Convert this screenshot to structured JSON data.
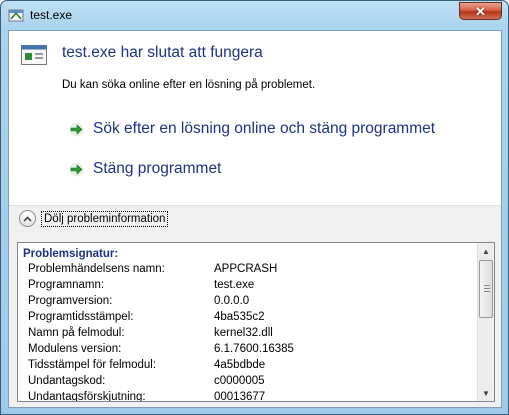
{
  "window": {
    "title": "test.exe"
  },
  "dialog": {
    "heading": "test.exe har slutat att fungera",
    "subtext": "Du kan söka online efter en lösning på problemet.",
    "commands": [
      {
        "label": "Sök efter en lösning online och stäng programmet"
      },
      {
        "label": "Stäng programmet"
      }
    ],
    "details_toggle": "Dölj probleminformation"
  },
  "details": {
    "header": "Problemsignatur:",
    "rows": [
      {
        "key": "Problemhändelsens namn:",
        "value": "APPCRASH"
      },
      {
        "key": "Programnamn:",
        "value": "test.exe"
      },
      {
        "key": "Programversion:",
        "value": "0.0.0.0"
      },
      {
        "key": "Programtidsstämpel:",
        "value": "4ba535c2"
      },
      {
        "key": "Namn på felmodul:",
        "value": "kernel32.dll"
      },
      {
        "key": "Modulens version:",
        "value": "6.1.7600.16385"
      },
      {
        "key": "Tidsstämpel för felmodul:",
        "value": "4a5bdbde"
      },
      {
        "key": "Undantagskod:",
        "value": "c0000005"
      },
      {
        "key": "Undantagsförskjutning:",
        "value": "00013677"
      }
    ]
  },
  "icons": {
    "app": "program-icon",
    "close": "close-icon",
    "command_arrow": "green-arrow-icon",
    "toggle": "chevron-up-icon"
  },
  "colors": {
    "link": "#1e3287",
    "frame": "#a9d3ee",
    "close": "#c74a31"
  }
}
